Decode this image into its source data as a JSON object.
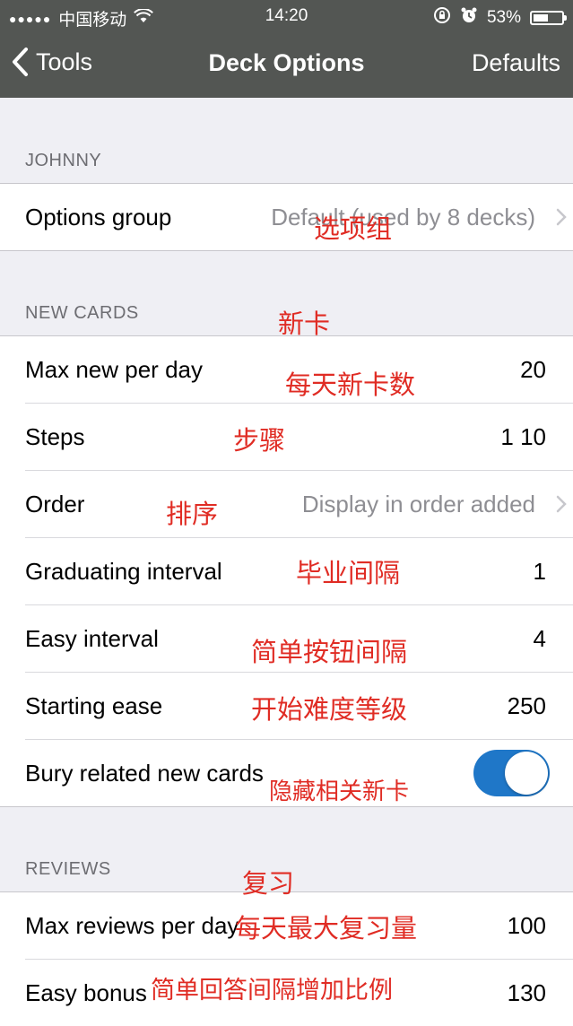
{
  "status_bar": {
    "signal": "●●●●●",
    "carrier": "中国移动",
    "time": "14:20",
    "battery": "53%",
    "battery_level": 0.53
  },
  "nav": {
    "back_label": "Tools",
    "title": "Deck Options",
    "right_label": "Defaults"
  },
  "sections": {
    "deck": {
      "header": "JOHNNY",
      "options_group_label": "Options group",
      "options_group_value": "Default (used by 8 decks)"
    },
    "new_cards": {
      "header": "NEW CARDS",
      "rows": [
        {
          "label": "Max new per day",
          "value": "20"
        },
        {
          "label": "Steps",
          "value": "1 10"
        },
        {
          "label": "Order",
          "value": "Display in order added"
        },
        {
          "label": "Graduating interval",
          "value": "1"
        },
        {
          "label": "Easy interval",
          "value": "4"
        },
        {
          "label": "Starting ease",
          "value": "250"
        },
        {
          "label": "Bury related new cards",
          "toggle": true
        }
      ]
    },
    "reviews": {
      "header": "REVIEWS",
      "rows": [
        {
          "label": "Max reviews per day",
          "value": "100"
        },
        {
          "label": "Easy bonus",
          "value": "130"
        }
      ]
    }
  },
  "annotations": {
    "options_group": "选项组",
    "new_cards": "新卡",
    "max_new": "每天新卡数",
    "steps": "步骤",
    "order": "排序",
    "graduating": "毕业间隔",
    "easy_interval": "简单按钮间隔",
    "starting_ease": "开始难度等级",
    "bury": "隐藏相关新卡",
    "reviews": "复习",
    "max_reviews": "每天最大复习量",
    "easy_bonus": "简单回答间隔增加比例"
  },
  "colors": {
    "bar": "#535653",
    "toggle_on": "#1f77c8",
    "annotation": "#e02c24"
  }
}
